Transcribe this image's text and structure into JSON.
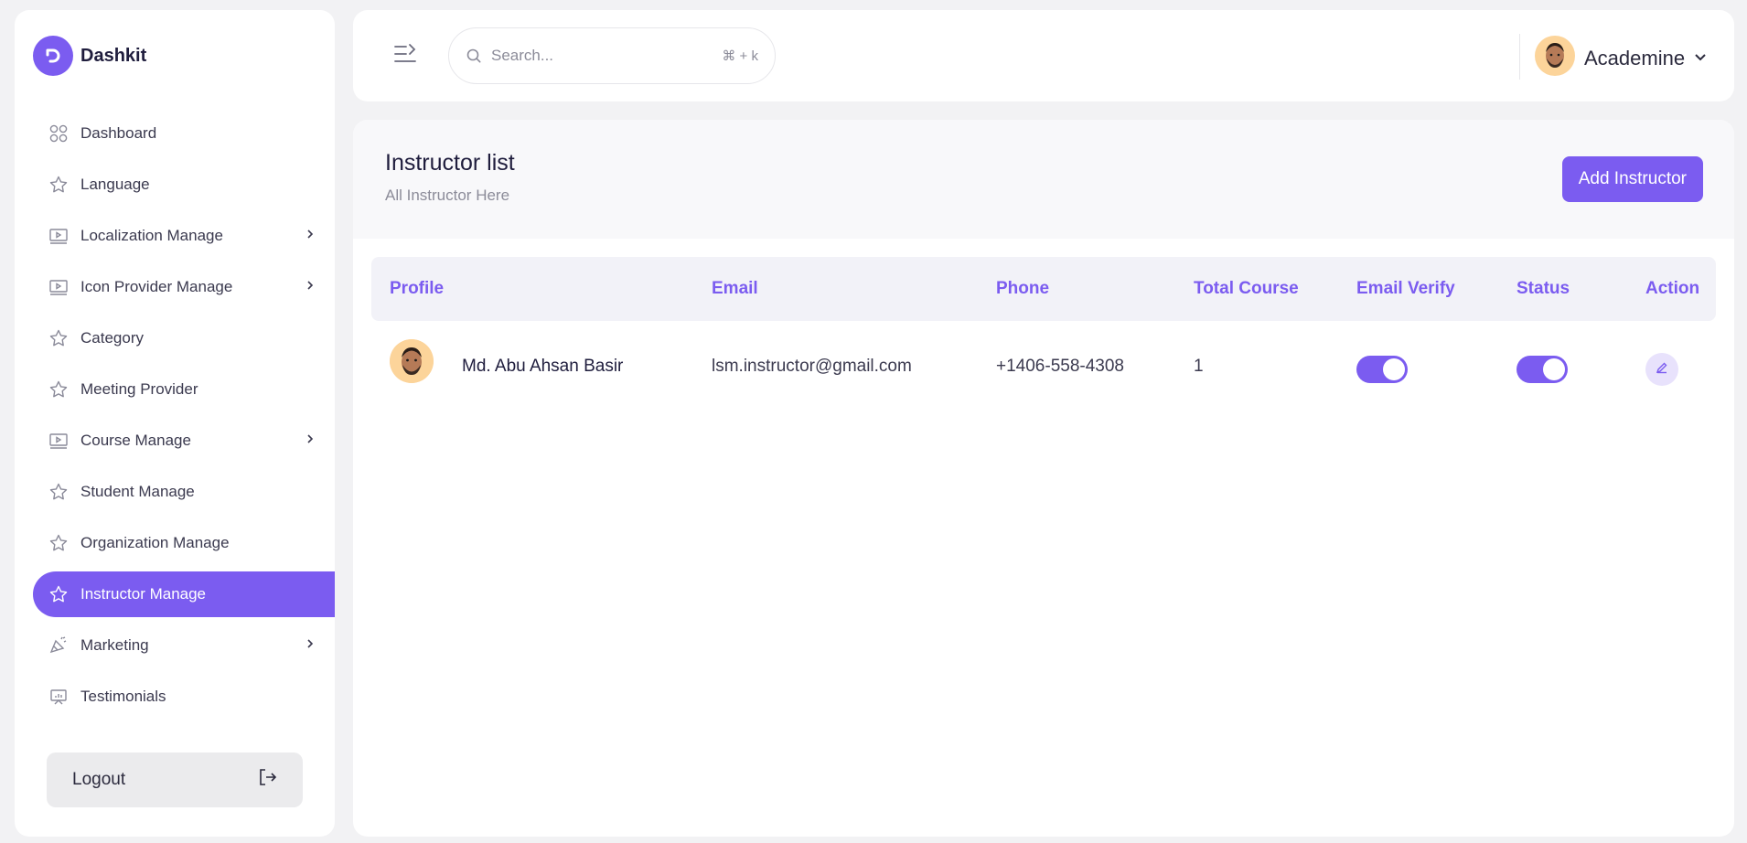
{
  "brand": {
    "name": "Dashkit",
    "icon": "brand-logo-icon"
  },
  "sidebar": {
    "items": [
      {
        "label": "Dashboard",
        "icon": "grid-icon",
        "has_submenu": false
      },
      {
        "label": "Language",
        "icon": "star-icon",
        "has_submenu": false
      },
      {
        "label": "Localization Manage",
        "icon": "screen-play-icon",
        "has_submenu": true
      },
      {
        "label": "Icon Provider Manage",
        "icon": "screen-play-icon",
        "has_submenu": true
      },
      {
        "label": "Category",
        "icon": "star-icon",
        "has_submenu": false
      },
      {
        "label": "Meeting Provider",
        "icon": "star-icon",
        "has_submenu": false
      },
      {
        "label": "Course Manage",
        "icon": "screen-play-icon",
        "has_submenu": true
      },
      {
        "label": "Student Manage",
        "icon": "star-icon",
        "has_submenu": false
      },
      {
        "label": "Organization Manage",
        "icon": "star-icon",
        "has_submenu": false
      },
      {
        "label": "Instructor Manage",
        "icon": "star-icon",
        "has_submenu": false,
        "active": true
      },
      {
        "label": "Marketing",
        "icon": "megaphone-icon",
        "has_submenu": true
      },
      {
        "label": "Testimonials",
        "icon": "presentation-icon",
        "has_submenu": false
      }
    ],
    "logout_label": "Logout"
  },
  "header": {
    "search_placeholder": "Search...",
    "search_shortcut": "⌘ + k",
    "user_name": "Academine"
  },
  "main": {
    "title": "Instructor list",
    "subtitle": "All Instructor Here",
    "add_button": "Add Instructor",
    "columns": [
      "Profile",
      "Email",
      "Phone",
      "Total Course",
      "Email Verify",
      "Status",
      "Action"
    ],
    "rows": [
      {
        "name": "Md. Abu Ahsan Basir",
        "email": "lsm.instructor@gmail.com",
        "phone": "+1406-558-4308",
        "total_course": "1",
        "email_verified": true,
        "status_active": true
      }
    ]
  },
  "colors": {
    "accent": "#7b5cf0",
    "background": "#f2f2f4",
    "text": "#1f1d3d"
  }
}
